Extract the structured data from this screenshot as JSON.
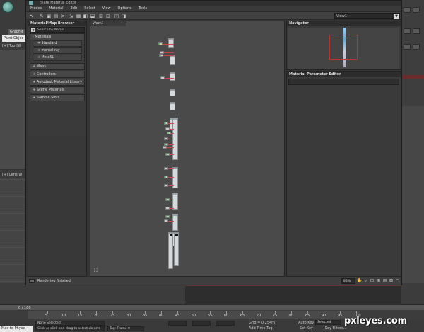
{
  "host": {
    "tab_graphite": "Graphit",
    "tab_paint": "Paint Objec",
    "viewport_top_label": "[+][Top][W",
    "viewport_left_label": "[+][Left][W",
    "time_counter": "0 / 100",
    "maxscript_label": "Max to Physc",
    "status_none_selected": "None Selected",
    "status_hint": "Click or click-and-drag to select objects",
    "status_frame": "Tag: Frame 0",
    "grid_label": "Grid = 0,254m",
    "auto_key": "Auto Key",
    "selected_option": "Selected",
    "set_key": "Set Key",
    "key_filters": "Key Filters...",
    "add_time_tag": "Add Time Tag",
    "ruler_labels": [
      "5",
      "10",
      "15",
      "20",
      "25",
      "30",
      "35",
      "40",
      "45",
      "50",
      "55",
      "60",
      "65",
      "70",
      "75",
      "80",
      "85",
      "90",
      "95",
      "100"
    ]
  },
  "editor": {
    "title": "Slate Material Editor",
    "menu": [
      "Modes",
      "Material",
      "Edit",
      "Select",
      "View",
      "Options",
      "Tools"
    ],
    "view_select_value": "View1",
    "browser": {
      "title": "Material/Map Browser",
      "search_placeholder": "Search by Name ...",
      "materials_group": "- Materials",
      "material_items": [
        "+ Standard",
        "+ mental ray",
        "+ MetaSL"
      ],
      "groups": [
        "+ Maps",
        "+ Controllers",
        "+ Autodesk Material Library",
        "+ Scene Materials",
        "+ Sample Slots"
      ]
    },
    "view_tab": "View1",
    "navigator_title": "Navigator",
    "mpe_title": "Material Parameter Editor",
    "status_text": "Rendering finished",
    "zoom_value": "83%"
  },
  "watermark": "pxleyes.com",
  "colors": {
    "wire": "#cc4444",
    "node": "#d6d9dc",
    "nav_frame": "#bb3333"
  }
}
